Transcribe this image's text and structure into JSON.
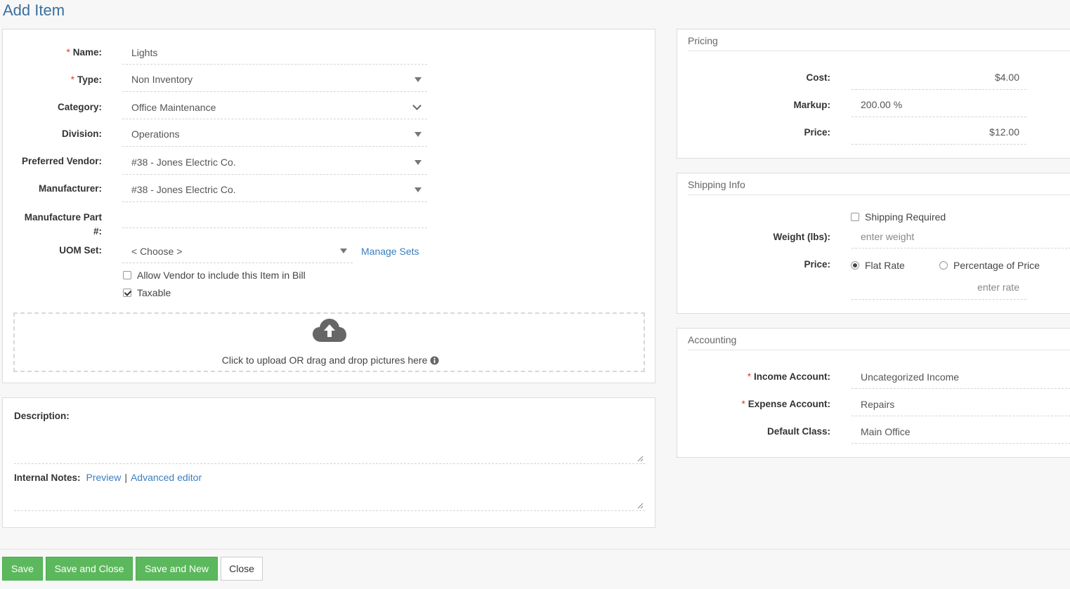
{
  "page": {
    "title": "Add Item"
  },
  "form": {
    "name": {
      "label": "Name:",
      "value": "Lights",
      "required": "*"
    },
    "type": {
      "label": "Type:",
      "value": "Non Inventory",
      "required": "*"
    },
    "category": {
      "label": "Category:",
      "value": "Office Maintenance"
    },
    "division": {
      "label": "Division:",
      "value": "Operations"
    },
    "preferred_vendor": {
      "label": "Preferred Vendor:",
      "value": "#38 - Jones Electric Co."
    },
    "manufacturer": {
      "label": "Manufacturer:",
      "value": "#38 - Jones Electric Co."
    },
    "manufacture_part": {
      "label_line1": "Manufacture Part",
      "label_line2": "#:",
      "value": ""
    },
    "uom_set": {
      "label": "UOM Set:",
      "value": "< Choose >",
      "manage_link": "Manage Sets"
    },
    "allow_vendor": {
      "label": "Allow Vendor to include this Item in Bill",
      "checked": false
    },
    "taxable": {
      "label": "Taxable",
      "checked": true
    },
    "upload": {
      "text": "Click to upload OR drag and drop pictures here",
      "icon": "cloud-upload-icon"
    }
  },
  "notes": {
    "description_label": "Description:",
    "internal_notes_label": "Internal Notes:",
    "preview_link": "Preview",
    "separator": "|",
    "advanced_editor_link": "Advanced editor"
  },
  "pricing": {
    "header": "Pricing",
    "cost": {
      "label": "Cost:",
      "value": "$4.00"
    },
    "markup": {
      "label": "Markup:",
      "value": "200.00 %"
    },
    "price": {
      "label": "Price:",
      "value": "$12.00"
    }
  },
  "shipping": {
    "header": "Shipping Info",
    "shipping_required": {
      "label": "Shipping Required",
      "checked": false
    },
    "weight": {
      "label": "Weight (lbs):",
      "placeholder": "enter weight"
    },
    "price": {
      "label": "Price:",
      "flat_rate": "Flat Rate",
      "percentage": "Percentage of Price",
      "selected": "Flat Rate",
      "rate_placeholder": "enter rate"
    }
  },
  "accounting": {
    "header": "Accounting",
    "income_account": {
      "label": "Income Account:",
      "value": "Uncategorized Income",
      "required": "*"
    },
    "expense_account": {
      "label": "Expense Account:",
      "value": "Repairs",
      "required": "*"
    },
    "default_class": {
      "label": "Default Class:",
      "value": "Main Office"
    }
  },
  "footer": {
    "save": "Save",
    "save_close": "Save and Close",
    "save_new": "Save and New",
    "close": "Close"
  },
  "colors": {
    "title": "#3a6f9e",
    "link": "#3a7fc0",
    "required": "#e2372a",
    "button_green": "#5cb85c"
  }
}
